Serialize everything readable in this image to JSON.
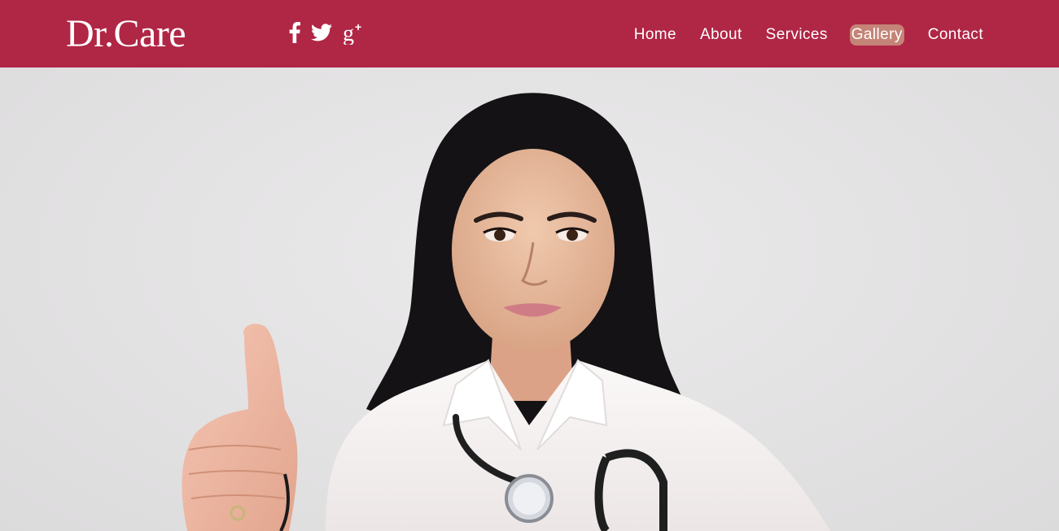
{
  "brand": {
    "name": "Dr.Care"
  },
  "social": [
    {
      "icon": "facebook-icon",
      "label": "f"
    },
    {
      "icon": "twitter-icon",
      "label": "twitter"
    },
    {
      "icon": "google-plus-icon",
      "label": "g+"
    }
  ],
  "nav": {
    "items": [
      {
        "label": "Home",
        "active": false
      },
      {
        "label": "About",
        "active": false
      },
      {
        "label": "Services",
        "active": false
      },
      {
        "label": "Gallery",
        "active": true
      },
      {
        "label": "Contact",
        "active": false
      }
    ]
  },
  "hero": {
    "subject": "doctor-thumbs-up-photo"
  },
  "colors": {
    "navbar": "#b02645",
    "text": "#ffffff",
    "hero_bg": "#e4e3e4",
    "active_highlight": "#d6d1a0"
  }
}
